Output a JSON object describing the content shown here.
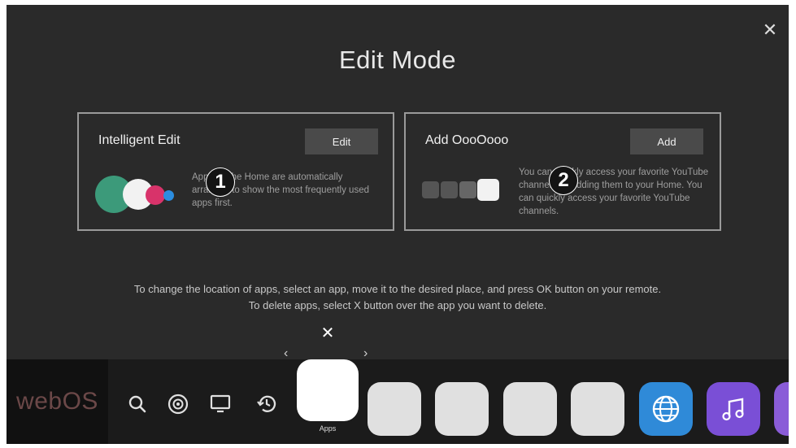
{
  "dialog": {
    "title": "Edit Mode",
    "close_glyph": "✕"
  },
  "cards": [
    {
      "title": "Intelligent Edit",
      "button_label": "Edit",
      "badge": "1",
      "description": "Apps on the Home are automatically arranged to show the most frequently used apps first."
    },
    {
      "title": "Add OooOooo",
      "button_label": "Add",
      "badge": "2",
      "description": "You can quickly access your favorite YouTube channels by adding them to your Home. You can quickly access your favorite YouTube channels."
    }
  ],
  "instructions": {
    "line1": "To change the location of apps, select an app, move it to the desired place, and press OK button on your remote.",
    "line2": "To delete apps, select X button over the app you want to delete."
  },
  "launcher": {
    "brand": "webOS",
    "selected_app_label": "Apps",
    "delete_glyph": "✕",
    "arrow_left": "‹",
    "arrow_right": "›",
    "nav_icons": [
      "search-icon",
      "input-icon",
      "tv-icon",
      "recent-icon"
    ],
    "app_icons": [
      "browser-icon",
      "music-icon"
    ]
  },
  "colors": {
    "background": "#2a2a2a",
    "launcher": "#1b1b1b",
    "browser": "#2f8ad8",
    "music": "#7a4fd6"
  }
}
